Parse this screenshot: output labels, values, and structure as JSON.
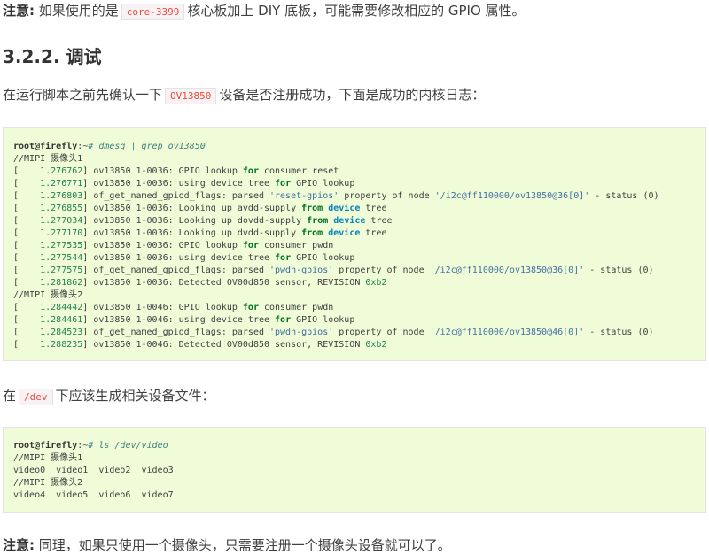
{
  "note1": {
    "label": "注意:",
    "text_before": "如果使用的是",
    "code": "core-3399",
    "text_after": "核心板加上 DIY 底板，可能需要修改相应的 GPIO 属性。"
  },
  "section_title": "3.2.2. 调试",
  "para1": {
    "text_before": "在运行脚本之前先确认一下",
    "code": "OV13850",
    "text_after": "设备是否注册成功，下面是成功的内核日志："
  },
  "code_block1": {
    "prompt_user": "root@firefly",
    "prompt_sep": ":~",
    "prompt_cmd": "# dmesg | grep ov13850",
    "comment1": "//MIPI 摄像头1",
    "comment2": "//MIPI 摄像头2",
    "log_cam1": [
      {
        "ts": "1.276762",
        "a": "] ov13850 1-0036: GPIO lookup ",
        "kw": "for",
        "b": " consumer reset",
        "kw2": "",
        "c": "",
        "str": "",
        "d": "",
        "str2": "",
        "e": ""
      },
      {
        "ts": "1.276771",
        "a": "] ov13850 1-0036: using device tree ",
        "kw": "for",
        "b": " GPIO lookup",
        "kw2": "",
        "c": "",
        "str": "",
        "d": "",
        "str2": "",
        "e": ""
      },
      {
        "ts": "1.276803",
        "a": "] of_get_named_gpiod_flags: parsed ",
        "kw": "",
        "b": "",
        "kw2": "",
        "c": "",
        "str": "'reset-gpios'",
        "d": " property of node ",
        "str2": "'/i2c@ff110000/ov13850@36[0]'",
        "e": " - status (0)"
      },
      {
        "ts": "1.276855",
        "a": "] ov13850 1-0036: Looking up avdd-supply ",
        "kw": "from",
        "b": " ",
        "kw2": "device",
        "c": " tree",
        "str": "",
        "d": "",
        "str2": "",
        "e": ""
      },
      {
        "ts": "1.277034",
        "a": "] ov13850 1-0036: Looking up dovdd-supply ",
        "kw": "from",
        "b": " ",
        "kw2": "device",
        "c": " tree",
        "str": "",
        "d": "",
        "str2": "",
        "e": ""
      },
      {
        "ts": "1.277170",
        "a": "] ov13850 1-0036: Looking up dvdd-supply ",
        "kw": "from",
        "b": " ",
        "kw2": "device",
        "c": " tree",
        "str": "",
        "d": "",
        "str2": "",
        "e": ""
      },
      {
        "ts": "1.277535",
        "a": "] ov13850 1-0036: GPIO lookup ",
        "kw": "for",
        "b": " consumer pwdn",
        "kw2": "",
        "c": "",
        "str": "",
        "d": "",
        "str2": "",
        "e": ""
      },
      {
        "ts": "1.277544",
        "a": "] ov13850 1-0036: using device tree ",
        "kw": "for",
        "b": " GPIO lookup",
        "kw2": "",
        "c": "",
        "str": "",
        "d": "",
        "str2": "",
        "e": ""
      },
      {
        "ts": "1.277575",
        "a": "] of_get_named_gpiod_flags: parsed ",
        "kw": "",
        "b": "",
        "kw2": "",
        "c": "",
        "str": "'pwdn-gpios'",
        "d": " property of node ",
        "str2": "'/i2c@ff110000/ov13850@36[0]'",
        "e": " - status (0)"
      },
      {
        "ts": "1.281862",
        "a": "] ov13850 1-0036: Detected OV00d850 sensor, REVISION ",
        "kw": "",
        "b": "",
        "kw2": "",
        "c": "",
        "str": "",
        "d": "",
        "str2": "",
        "e": "",
        "num": "0xb2"
      }
    ],
    "log_cam2": [
      {
        "ts": "1.284442",
        "a": "] ov13850 1-0046: GPIO lookup ",
        "kw": "for",
        "b": " consumer pwdn",
        "kw2": "",
        "c": "",
        "str": "",
        "d": "",
        "str2": "",
        "e": ""
      },
      {
        "ts": "1.284461",
        "a": "] ov13850 1-0046: using device tree ",
        "kw": "for",
        "b": " GPIO lookup",
        "kw2": "",
        "c": "",
        "str": "",
        "d": "",
        "str2": "",
        "e": ""
      },
      {
        "ts": "1.284523",
        "a": "] of_get_named_gpiod_flags: parsed ",
        "kw": "",
        "b": "",
        "kw2": "",
        "c": "",
        "str": "'pwdn-gpios'",
        "d": " property of node ",
        "str2": "'/i2c@ff110000/ov13850@46[0]'",
        "e": " - status (0)"
      },
      {
        "ts": "1.288235",
        "a": "] ov13850 1-0046: Detected OV00d850 sensor, REVISION ",
        "kw": "",
        "b": "",
        "kw2": "",
        "c": "",
        "str": "",
        "d": "",
        "str2": "",
        "e": "",
        "num": "0xb2"
      }
    ]
  },
  "para2": {
    "text_before": "在",
    "code": "/dev",
    "text_after": "下应该生成相关设备文件："
  },
  "code_block2": {
    "prompt_user": "root@firefly",
    "prompt_sep": ":~",
    "prompt_cmd": "# ls /dev/video",
    "comment1": "//MIPI 摄像头1",
    "devices1": "video0  video1  video2  video3",
    "comment2": "//MIPI 摄像头2",
    "devices2": "video4  video5  video6  video7"
  },
  "note2": {
    "label": "注意:",
    "text": "同理，如果只使用一个摄像头，只需要注册一个摄像头设备就可以了。"
  }
}
